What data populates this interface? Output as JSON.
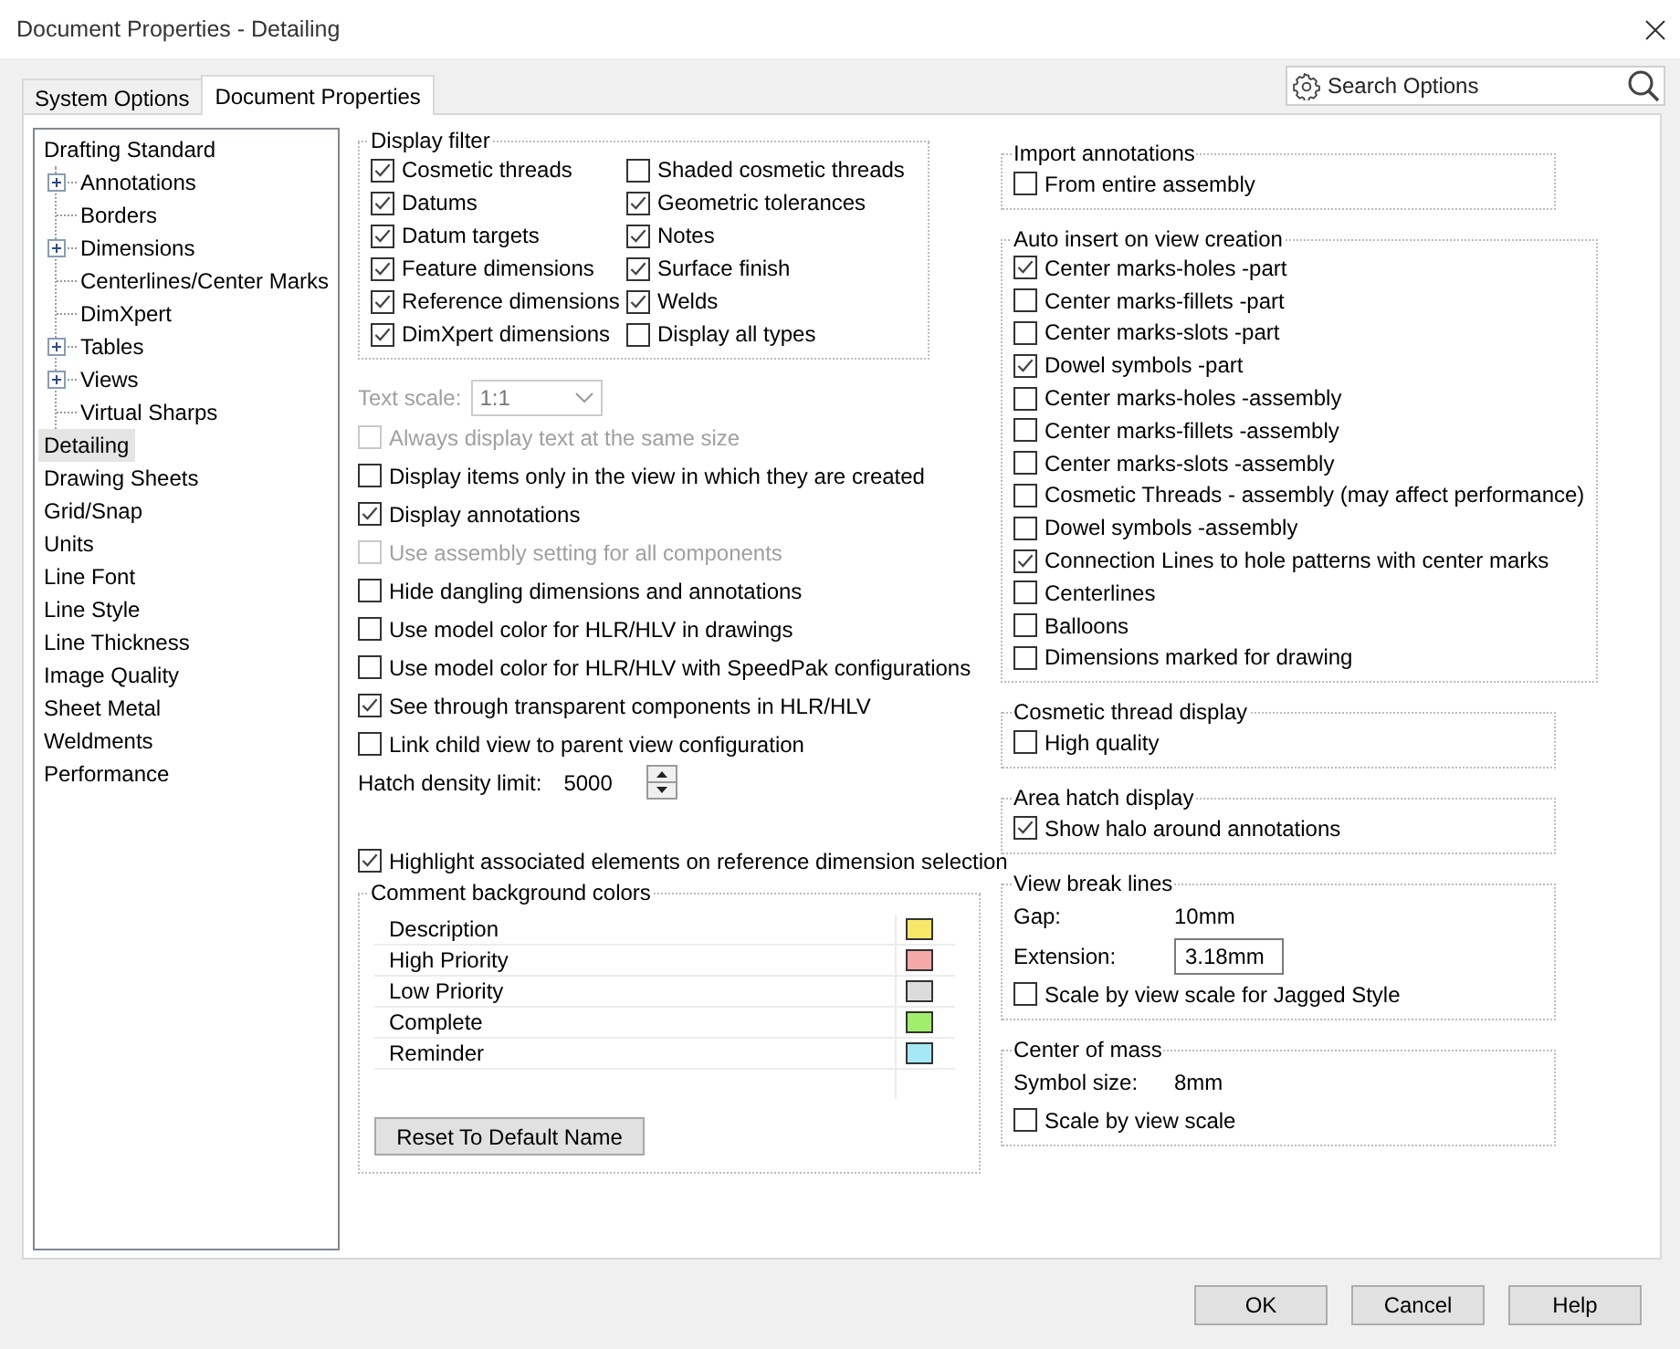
{
  "window": {
    "title": "Document Properties - Detailing"
  },
  "tabs": [
    {
      "label": "System Options",
      "selected": false
    },
    {
      "label": "Document Properties",
      "selected": true
    }
  ],
  "search": {
    "placeholder": "Search Options"
  },
  "tree": [
    {
      "label": "Drafting Standard",
      "selected": false,
      "children": [
        {
          "label": "Annotations",
          "expandable": true,
          "selected": false
        },
        {
          "label": "Borders",
          "expandable": false,
          "selected": false
        },
        {
          "label": "Dimensions",
          "expandable": true,
          "selected": false
        },
        {
          "label": "Centerlines/Center Marks",
          "expandable": false,
          "selected": false
        },
        {
          "label": "DimXpert",
          "expandable": false,
          "selected": false
        },
        {
          "label": "Tables",
          "expandable": true,
          "selected": false
        },
        {
          "label": "Views",
          "expandable": true,
          "selected": false
        },
        {
          "label": "Virtual Sharps",
          "expandable": false,
          "selected": false
        }
      ]
    },
    {
      "label": "Detailing",
      "selected": true
    },
    {
      "label": "Drawing Sheets",
      "selected": false
    },
    {
      "label": "Grid/Snap",
      "selected": false
    },
    {
      "label": "Units",
      "selected": false
    },
    {
      "label": "Line Font",
      "selected": false
    },
    {
      "label": "Line Style",
      "selected": false
    },
    {
      "label": "Line Thickness",
      "selected": false
    },
    {
      "label": "Image Quality",
      "selected": false
    },
    {
      "label": "Sheet Metal",
      "selected": false
    },
    {
      "label": "Weldments",
      "selected": false
    },
    {
      "label": "Performance",
      "selected": false
    }
  ],
  "display_filter": {
    "title": "Display filter",
    "items": [
      {
        "label": "Cosmetic threads",
        "checked": true
      },
      {
        "label": "Datums",
        "checked": true
      },
      {
        "label": "Datum targets",
        "checked": true
      },
      {
        "label": "Feature dimensions",
        "checked": true
      },
      {
        "label": "Reference dimensions",
        "checked": true
      },
      {
        "label": "DimXpert dimensions",
        "checked": true
      },
      {
        "label": "Shaded cosmetic threads",
        "checked": false
      },
      {
        "label": "Geometric tolerances",
        "checked": true
      },
      {
        "label": "Notes",
        "checked": true
      },
      {
        "label": "Surface finish",
        "checked": true
      },
      {
        "label": "Welds",
        "checked": true
      },
      {
        "label": "Display all types",
        "checked": false
      }
    ]
  },
  "text_scale": {
    "label": "Text scale:",
    "value": "1:1",
    "disabled": true
  },
  "options": [
    {
      "kind": "check",
      "label": "Always display text at the same size",
      "checked": false,
      "disabled": true
    },
    {
      "kind": "check",
      "label": "Display items only in the view in which they are created",
      "checked": false,
      "disabled": false
    },
    {
      "kind": "check",
      "label": "Display annotations",
      "checked": true,
      "disabled": false
    },
    {
      "kind": "check",
      "label": "Use assembly setting for all components",
      "checked": false,
      "disabled": true
    },
    {
      "kind": "check",
      "label": "Hide dangling dimensions and annotations",
      "checked": false,
      "disabled": false
    },
    {
      "kind": "check",
      "label": "Use model color for HLR/HLV in drawings",
      "checked": false,
      "disabled": false
    },
    {
      "kind": "check",
      "label": "Use model color for HLR/HLV with SpeedPak configurations",
      "checked": false,
      "disabled": false
    },
    {
      "kind": "check",
      "label": "See through transparent components in HLR/HLV",
      "checked": true,
      "disabled": false
    },
    {
      "kind": "check",
      "label": "Link child view to parent view configuration",
      "checked": false,
      "disabled": false
    },
    {
      "kind": "spin",
      "label": "Hatch density limit:",
      "value": "5000"
    }
  ],
  "highlight": {
    "label": "Highlight associated elements on reference dimension selection",
    "checked": true
  },
  "comment_colors": {
    "title": "Comment background colors",
    "rows": [
      {
        "label": "Description",
        "color": "#f7e86a"
      },
      {
        "label": "High Priority",
        "color": "#f4a8a8"
      },
      {
        "label": "Low Priority",
        "color": "#dcdcdc"
      },
      {
        "label": "Complete",
        "color": "#a0ee6c"
      },
      {
        "label": "Reminder",
        "color": "#a6e8f4"
      }
    ],
    "button": "Reset To Default Name"
  },
  "right_groups": [
    {
      "title": "Import annotations",
      "items": [
        {
          "label": "From entire assembly",
          "checked": false
        }
      ]
    },
    {
      "title": "Auto insert on view creation",
      "items": [
        {
          "label": "Center marks-holes -part",
          "checked": true
        },
        {
          "label": "Center marks-fillets -part",
          "checked": false
        },
        {
          "label": "Center marks-slots  -part",
          "checked": false
        },
        {
          "label": "Dowel symbols -part",
          "checked": true
        },
        {
          "label": "Center marks-holes -assembly",
          "checked": false
        },
        {
          "label": "Center marks-fillets -assembly",
          "checked": false
        },
        {
          "label": "Center marks-slots  -assembly",
          "checked": false
        },
        {
          "label": "Cosmetic Threads - assembly (may affect performance)",
          "checked": false
        },
        {
          "label": "Dowel symbols -assembly",
          "checked": false
        },
        {
          "label": "Connection Lines to hole patterns with center marks",
          "checked": true
        },
        {
          "label": "Centerlines",
          "checked": false
        },
        {
          "label": "Balloons",
          "checked": false
        },
        {
          "label": "Dimensions marked for drawing",
          "checked": false
        }
      ]
    },
    {
      "title": "Cosmetic thread display",
      "items": [
        {
          "label": "High quality",
          "checked": false
        }
      ]
    },
    {
      "title": "Area hatch display",
      "items": [
        {
          "label": "Show halo around annotations",
          "checked": true
        }
      ]
    },
    {
      "title": "View break lines",
      "fields": [
        {
          "kind": "static",
          "label": "Gap:",
          "value": "10mm"
        },
        {
          "kind": "input",
          "label": "Extension:",
          "value": "3.18mm"
        }
      ],
      "items": [
        {
          "label": "Scale by view scale for Jagged Style",
          "checked": false
        }
      ]
    },
    {
      "title": "Center of mass",
      "fields": [
        {
          "kind": "static",
          "label": "Symbol size:",
          "value": "8mm"
        }
      ],
      "items": [
        {
          "label": "Scale by view scale",
          "checked": false
        }
      ]
    }
  ],
  "buttons": [
    "OK",
    "Cancel",
    "Help"
  ]
}
